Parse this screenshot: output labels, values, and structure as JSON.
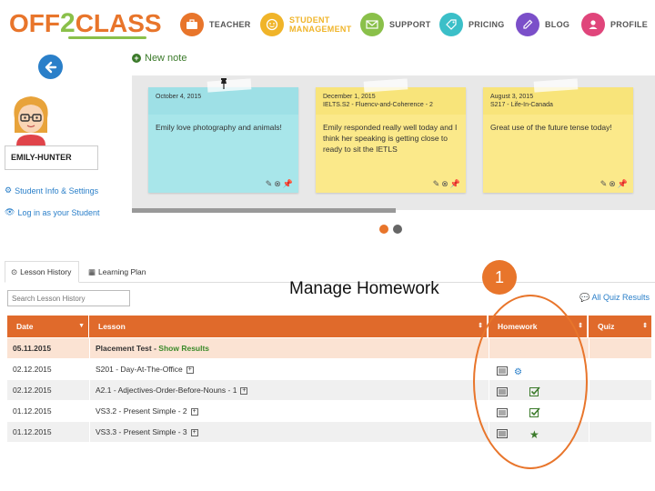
{
  "header": {
    "logo_part1": "OFF",
    "logo_part2": "2",
    "logo_part3": "CLASS",
    "nav": [
      {
        "label_line1": "TEACHER",
        "label_line2": "",
        "icon": "briefcase-icon",
        "color": "#e8752b"
      },
      {
        "label_line1": "STUDENT",
        "label_line2": "MANAGEMENT",
        "icon": "face-icon",
        "color": "#f0b429"
      },
      {
        "label_line1": "SUPPORT",
        "label_line2": "",
        "icon": "envelope-icon",
        "color": "#8ac04a"
      },
      {
        "label_line1": "PRICING",
        "label_line2": "",
        "icon": "tag-icon",
        "color": "#3bbfc8"
      },
      {
        "label_line1": "BLOG",
        "label_line2": "",
        "icon": "pencil-icon",
        "color": "#7b4fc9"
      },
      {
        "label_line1": "PROFILE",
        "label_line2": "",
        "icon": "user-icon",
        "color": "#e0457b"
      }
    ]
  },
  "student": {
    "name": "EMILY-HUNTER",
    "links": [
      "Student Info & Settings",
      "Log in as your Student"
    ]
  },
  "notes": {
    "new_note_label": "New note",
    "items": [
      {
        "date": "October 4, 2015",
        "subtitle": "",
        "body": "Emily love photography and animals!",
        "color": "#a8e6ea",
        "head_color": "#9ee0e6"
      },
      {
        "date": "December 1, 2015",
        "subtitle": "IELTS.S2 - Fluencv-and-Coherence - 2",
        "body": "Emily responded really well today and I think her speaking is getting close to ready to sit the IETLS",
        "color": "#fbe98a",
        "head_color": "#f8e47a"
      },
      {
        "date": "August 3, 2015",
        "subtitle": "S217 - Life-In-Canada",
        "body": "Great use of the future tense today!",
        "color": "#fbe98a",
        "head_color": "#f8e47a"
      }
    ]
  },
  "tabs": [
    {
      "label": "Lesson History",
      "icon": "clock-icon"
    },
    {
      "label": "Learning Plan",
      "icon": "calendar-icon"
    }
  ],
  "search_placeholder": "Search Lesson History",
  "annotation": {
    "label": "Manage Homework",
    "badge": "1"
  },
  "all_quiz_label": "All Quiz Results",
  "table": {
    "headers": [
      "Date",
      "Lesson",
      "Homework",
      "Quiz"
    ],
    "rows": [
      {
        "date": "05.11.2015",
        "lesson": "Placement Test - ",
        "link": "Show Results",
        "hw": "none"
      },
      {
        "date": "02.12.2015",
        "lesson": "S201 - Day-At-The-Office",
        "link": "",
        "hw": "gear"
      },
      {
        "date": "02.12.2015",
        "lesson": "A2.1 - Adjectives-Order-Before-Nouns - 1",
        "link": "",
        "hw": "check"
      },
      {
        "date": "01.12.2015",
        "lesson": "VS3.2 - Present Simple - 2",
        "link": "",
        "hw": "check"
      },
      {
        "date": "01.12.2015",
        "lesson": "VS3.3 - Present Simple - 3",
        "link": "",
        "hw": "star"
      }
    ]
  },
  "colors": {
    "brand_orange": "#e8752b",
    "brand_green": "#8ac04a",
    "link_blue": "#2a7fc9",
    "table_header": "#e06a2b",
    "highlight_row": "#fbe3d3"
  }
}
